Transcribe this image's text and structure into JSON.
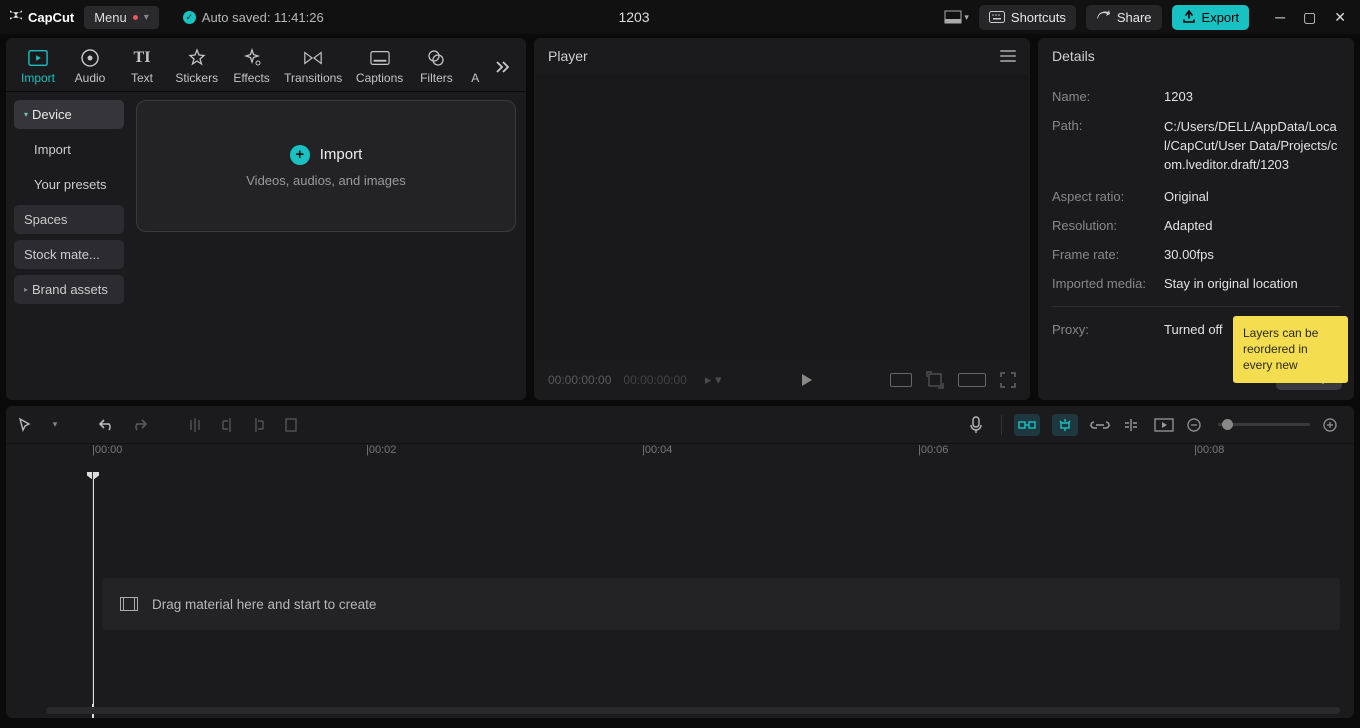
{
  "app_name": "CapCut",
  "menu_label": "Menu",
  "autosave_label": "Auto saved: 11:41:26",
  "project_title": "1203",
  "title_right": {
    "shortcuts": "Shortcuts",
    "share": "Share",
    "export": "Export"
  },
  "media_tabs": [
    {
      "label": "Import",
      "active": true
    },
    {
      "label": "Audio"
    },
    {
      "label": "Text"
    },
    {
      "label": "Stickers"
    },
    {
      "label": "Effects"
    },
    {
      "label": "Transitions"
    },
    {
      "label": "Captions"
    },
    {
      "label": "Filters"
    }
  ],
  "sidebar": {
    "device": "Device",
    "import": "Import",
    "presets": "Your presets",
    "spaces": "Spaces",
    "stock": "Stock mate...",
    "brand": "Brand assets"
  },
  "import_box": {
    "title": "Import",
    "sub": "Videos, audios, and images"
  },
  "player": {
    "title": "Player",
    "time_current": "00:00:00:00",
    "time_total": "00:00:00:00"
  },
  "details": {
    "title": "Details",
    "rows": {
      "name_k": "Name:",
      "name_v": "1203",
      "path_k": "Path:",
      "path_v": "C:/Users/DELL/AppData/Local/CapCut/User Data/Projects/com.lveditor.draft/1203",
      "aspect_k": "Aspect ratio:",
      "aspect_v": "Original",
      "res_k": "Resolution:",
      "res_v": "Adapted",
      "fps_k": "Frame rate:",
      "fps_v": "30.00fps",
      "imp_k": "Imported media:",
      "imp_v": "Stay in original location",
      "proxy_k": "Proxy:",
      "proxy_v": "Turned off"
    },
    "modify": "Modify"
  },
  "tooltip": "Layers can be reordered in every new",
  "ruler": [
    "00:00",
    "00:02",
    "00:04",
    "00:06",
    "00:08"
  ],
  "drop_hint": "Drag material here and start to create"
}
